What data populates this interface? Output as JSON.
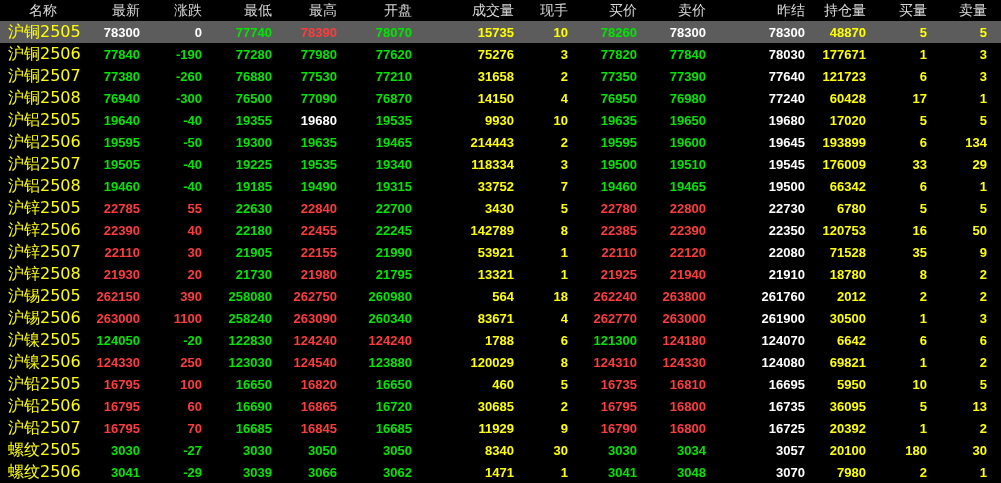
{
  "table": {
    "columns": [
      "名称",
      "最新",
      "涨跌",
      "最低",
      "最高",
      "开盘",
      "成交量",
      "现手",
      "买价",
      "卖价",
      "昨结",
      "持仓量",
      "买量",
      "卖量"
    ],
    "rows": [
      {
        "selected": true,
        "cells": [
          {
            "text": "沪铜2505",
            "color": "#ffff00"
          },
          {
            "text": "78300",
            "color": "#ffffff"
          },
          {
            "text": "0",
            "color": "#ffffff"
          },
          {
            "text": "77740",
            "color": "#00e600"
          },
          {
            "text": "78390",
            "color": "#ff3c3c"
          },
          {
            "text": "78070",
            "color": "#00e600"
          },
          {
            "text": "15735",
            "color": "#ffff00"
          },
          {
            "text": "10",
            "color": "#ffff00"
          },
          {
            "text": "78260",
            "color": "#00e600"
          },
          {
            "text": "78300",
            "color": "#ffffff"
          },
          {
            "text": "78300",
            "color": "#ffffff"
          },
          {
            "text": "48870",
            "color": "#ffff00"
          },
          {
            "text": "5",
            "color": "#ffff00"
          },
          {
            "text": "5",
            "color": "#ffff00"
          }
        ]
      },
      {
        "selected": false,
        "cells": [
          {
            "text": "沪铜2506",
            "color": "#ffff00"
          },
          {
            "text": "77840",
            "color": "#00e600"
          },
          {
            "text": "-190",
            "color": "#00e600"
          },
          {
            "text": "77280",
            "color": "#00e600"
          },
          {
            "text": "77980",
            "color": "#00e600"
          },
          {
            "text": "77620",
            "color": "#00e600"
          },
          {
            "text": "75276",
            "color": "#ffff00"
          },
          {
            "text": "3",
            "color": "#ffff00"
          },
          {
            "text": "77820",
            "color": "#00e600"
          },
          {
            "text": "77840",
            "color": "#00e600"
          },
          {
            "text": "78030",
            "color": "#ffffff"
          },
          {
            "text": "177671",
            "color": "#ffff00"
          },
          {
            "text": "1",
            "color": "#ffff00"
          },
          {
            "text": "3",
            "color": "#ffff00"
          }
        ]
      },
      {
        "selected": false,
        "cells": [
          {
            "text": "沪铜2507",
            "color": "#ffff00"
          },
          {
            "text": "77380",
            "color": "#00e600"
          },
          {
            "text": "-260",
            "color": "#00e600"
          },
          {
            "text": "76880",
            "color": "#00e600"
          },
          {
            "text": "77530",
            "color": "#00e600"
          },
          {
            "text": "77210",
            "color": "#00e600"
          },
          {
            "text": "31658",
            "color": "#ffff00"
          },
          {
            "text": "2",
            "color": "#ffff00"
          },
          {
            "text": "77350",
            "color": "#00e600"
          },
          {
            "text": "77390",
            "color": "#00e600"
          },
          {
            "text": "77640",
            "color": "#ffffff"
          },
          {
            "text": "121723",
            "color": "#ffff00"
          },
          {
            "text": "6",
            "color": "#ffff00"
          },
          {
            "text": "3",
            "color": "#ffff00"
          }
        ]
      },
      {
        "selected": false,
        "cells": [
          {
            "text": "沪铜2508",
            "color": "#ffff00"
          },
          {
            "text": "76940",
            "color": "#00e600"
          },
          {
            "text": "-300",
            "color": "#00e600"
          },
          {
            "text": "76500",
            "color": "#00e600"
          },
          {
            "text": "77090",
            "color": "#00e600"
          },
          {
            "text": "76870",
            "color": "#00e600"
          },
          {
            "text": "14150",
            "color": "#ffff00"
          },
          {
            "text": "4",
            "color": "#ffff00"
          },
          {
            "text": "76950",
            "color": "#00e600"
          },
          {
            "text": "76980",
            "color": "#00e600"
          },
          {
            "text": "77240",
            "color": "#ffffff"
          },
          {
            "text": "60428",
            "color": "#ffff00"
          },
          {
            "text": "17",
            "color": "#ffff00"
          },
          {
            "text": "1",
            "color": "#ffff00"
          }
        ]
      },
      {
        "selected": false,
        "cells": [
          {
            "text": "沪铝2505",
            "color": "#ffff00"
          },
          {
            "text": "19640",
            "color": "#00e600"
          },
          {
            "text": "-40",
            "color": "#00e600"
          },
          {
            "text": "19355",
            "color": "#00e600"
          },
          {
            "text": "19680",
            "color": "#ffffff"
          },
          {
            "text": "19535",
            "color": "#00e600"
          },
          {
            "text": "9930",
            "color": "#ffff00"
          },
          {
            "text": "10",
            "color": "#ffff00"
          },
          {
            "text": "19635",
            "color": "#00e600"
          },
          {
            "text": "19650",
            "color": "#00e600"
          },
          {
            "text": "19680",
            "color": "#ffffff"
          },
          {
            "text": "17020",
            "color": "#ffff00"
          },
          {
            "text": "5",
            "color": "#ffff00"
          },
          {
            "text": "5",
            "color": "#ffff00"
          }
        ]
      },
      {
        "selected": false,
        "cells": [
          {
            "text": "沪铝2506",
            "color": "#ffff00"
          },
          {
            "text": "19595",
            "color": "#00e600"
          },
          {
            "text": "-50",
            "color": "#00e600"
          },
          {
            "text": "19300",
            "color": "#00e600"
          },
          {
            "text": "19635",
            "color": "#00e600"
          },
          {
            "text": "19465",
            "color": "#00e600"
          },
          {
            "text": "214443",
            "color": "#ffff00"
          },
          {
            "text": "2",
            "color": "#ffff00"
          },
          {
            "text": "19595",
            "color": "#00e600"
          },
          {
            "text": "19600",
            "color": "#00e600"
          },
          {
            "text": "19645",
            "color": "#ffffff"
          },
          {
            "text": "193899",
            "color": "#ffff00"
          },
          {
            "text": "6",
            "color": "#ffff00"
          },
          {
            "text": "134",
            "color": "#ffff00"
          }
        ]
      },
      {
        "selected": false,
        "cells": [
          {
            "text": "沪铝2507",
            "color": "#ffff00"
          },
          {
            "text": "19505",
            "color": "#00e600"
          },
          {
            "text": "-40",
            "color": "#00e600"
          },
          {
            "text": "19225",
            "color": "#00e600"
          },
          {
            "text": "19535",
            "color": "#00e600"
          },
          {
            "text": "19340",
            "color": "#00e600"
          },
          {
            "text": "118334",
            "color": "#ffff00"
          },
          {
            "text": "3",
            "color": "#ffff00"
          },
          {
            "text": "19500",
            "color": "#00e600"
          },
          {
            "text": "19510",
            "color": "#00e600"
          },
          {
            "text": "19545",
            "color": "#ffffff"
          },
          {
            "text": "176009",
            "color": "#ffff00"
          },
          {
            "text": "33",
            "color": "#ffff00"
          },
          {
            "text": "29",
            "color": "#ffff00"
          }
        ]
      },
      {
        "selected": false,
        "cells": [
          {
            "text": "沪铝2508",
            "color": "#ffff00"
          },
          {
            "text": "19460",
            "color": "#00e600"
          },
          {
            "text": "-40",
            "color": "#00e600"
          },
          {
            "text": "19185",
            "color": "#00e600"
          },
          {
            "text": "19490",
            "color": "#00e600"
          },
          {
            "text": "19315",
            "color": "#00e600"
          },
          {
            "text": "33752",
            "color": "#ffff00"
          },
          {
            "text": "7",
            "color": "#ffff00"
          },
          {
            "text": "19460",
            "color": "#00e600"
          },
          {
            "text": "19465",
            "color": "#00e600"
          },
          {
            "text": "19500",
            "color": "#ffffff"
          },
          {
            "text": "66342",
            "color": "#ffff00"
          },
          {
            "text": "6",
            "color": "#ffff00"
          },
          {
            "text": "1",
            "color": "#ffff00"
          }
        ]
      },
      {
        "selected": false,
        "cells": [
          {
            "text": "沪锌2505",
            "color": "#ffff00"
          },
          {
            "text": "22785",
            "color": "#ff3c3c"
          },
          {
            "text": "55",
            "color": "#ff3c3c"
          },
          {
            "text": "22630",
            "color": "#00e600"
          },
          {
            "text": "22840",
            "color": "#ff3c3c"
          },
          {
            "text": "22700",
            "color": "#00e600"
          },
          {
            "text": "3430",
            "color": "#ffff00"
          },
          {
            "text": "5",
            "color": "#ffff00"
          },
          {
            "text": "22780",
            "color": "#ff3c3c"
          },
          {
            "text": "22800",
            "color": "#ff3c3c"
          },
          {
            "text": "22730",
            "color": "#ffffff"
          },
          {
            "text": "6780",
            "color": "#ffff00"
          },
          {
            "text": "5",
            "color": "#ffff00"
          },
          {
            "text": "5",
            "color": "#ffff00"
          }
        ]
      },
      {
        "selected": false,
        "cells": [
          {
            "text": "沪锌2506",
            "color": "#ffff00"
          },
          {
            "text": "22390",
            "color": "#ff3c3c"
          },
          {
            "text": "40",
            "color": "#ff3c3c"
          },
          {
            "text": "22180",
            "color": "#00e600"
          },
          {
            "text": "22455",
            "color": "#ff3c3c"
          },
          {
            "text": "22245",
            "color": "#00e600"
          },
          {
            "text": "142789",
            "color": "#ffff00"
          },
          {
            "text": "8",
            "color": "#ffff00"
          },
          {
            "text": "22385",
            "color": "#ff3c3c"
          },
          {
            "text": "22390",
            "color": "#ff3c3c"
          },
          {
            "text": "22350",
            "color": "#ffffff"
          },
          {
            "text": "120753",
            "color": "#ffff00"
          },
          {
            "text": "16",
            "color": "#ffff00"
          },
          {
            "text": "50",
            "color": "#ffff00"
          }
        ]
      },
      {
        "selected": false,
        "cells": [
          {
            "text": "沪锌2507",
            "color": "#ffff00"
          },
          {
            "text": "22110",
            "color": "#ff3c3c"
          },
          {
            "text": "30",
            "color": "#ff3c3c"
          },
          {
            "text": "21905",
            "color": "#00e600"
          },
          {
            "text": "22155",
            "color": "#ff3c3c"
          },
          {
            "text": "21990",
            "color": "#00e600"
          },
          {
            "text": "53921",
            "color": "#ffff00"
          },
          {
            "text": "1",
            "color": "#ffff00"
          },
          {
            "text": "22110",
            "color": "#ff3c3c"
          },
          {
            "text": "22120",
            "color": "#ff3c3c"
          },
          {
            "text": "22080",
            "color": "#ffffff"
          },
          {
            "text": "71528",
            "color": "#ffff00"
          },
          {
            "text": "35",
            "color": "#ffff00"
          },
          {
            "text": "9",
            "color": "#ffff00"
          }
        ]
      },
      {
        "selected": false,
        "cells": [
          {
            "text": "沪锌2508",
            "color": "#ffff00"
          },
          {
            "text": "21930",
            "color": "#ff3c3c"
          },
          {
            "text": "20",
            "color": "#ff3c3c"
          },
          {
            "text": "21730",
            "color": "#00e600"
          },
          {
            "text": "21980",
            "color": "#ff3c3c"
          },
          {
            "text": "21795",
            "color": "#00e600"
          },
          {
            "text": "13321",
            "color": "#ffff00"
          },
          {
            "text": "1",
            "color": "#ffff00"
          },
          {
            "text": "21925",
            "color": "#ff3c3c"
          },
          {
            "text": "21940",
            "color": "#ff3c3c"
          },
          {
            "text": "21910",
            "color": "#ffffff"
          },
          {
            "text": "18780",
            "color": "#ffff00"
          },
          {
            "text": "8",
            "color": "#ffff00"
          },
          {
            "text": "2",
            "color": "#ffff00"
          }
        ]
      },
      {
        "selected": false,
        "cells": [
          {
            "text": "沪锡2505",
            "color": "#ffff00"
          },
          {
            "text": "262150",
            "color": "#ff3c3c"
          },
          {
            "text": "390",
            "color": "#ff3c3c"
          },
          {
            "text": "258080",
            "color": "#00e600"
          },
          {
            "text": "262750",
            "color": "#ff3c3c"
          },
          {
            "text": "260980",
            "color": "#00e600"
          },
          {
            "text": "564",
            "color": "#ffff00"
          },
          {
            "text": "18",
            "color": "#ffff00"
          },
          {
            "text": "262240",
            "color": "#ff3c3c"
          },
          {
            "text": "263800",
            "color": "#ff3c3c"
          },
          {
            "text": "261760",
            "color": "#ffffff"
          },
          {
            "text": "2012",
            "color": "#ffff00"
          },
          {
            "text": "2",
            "color": "#ffff00"
          },
          {
            "text": "2",
            "color": "#ffff00"
          }
        ]
      },
      {
        "selected": false,
        "cells": [
          {
            "text": "沪锡2506",
            "color": "#ffff00"
          },
          {
            "text": "263000",
            "color": "#ff3c3c"
          },
          {
            "text": "1100",
            "color": "#ff3c3c"
          },
          {
            "text": "258240",
            "color": "#00e600"
          },
          {
            "text": "263090",
            "color": "#ff3c3c"
          },
          {
            "text": "260340",
            "color": "#00e600"
          },
          {
            "text": "83671",
            "color": "#ffff00"
          },
          {
            "text": "4",
            "color": "#ffff00"
          },
          {
            "text": "262770",
            "color": "#ff3c3c"
          },
          {
            "text": "263000",
            "color": "#ff3c3c"
          },
          {
            "text": "261900",
            "color": "#ffffff"
          },
          {
            "text": "30500",
            "color": "#ffff00"
          },
          {
            "text": "1",
            "color": "#ffff00"
          },
          {
            "text": "3",
            "color": "#ffff00"
          }
        ]
      },
      {
        "selected": false,
        "cells": [
          {
            "text": "沪镍2505",
            "color": "#ffff00"
          },
          {
            "text": "124050",
            "color": "#00e600"
          },
          {
            "text": "-20",
            "color": "#00e600"
          },
          {
            "text": "122830",
            "color": "#00e600"
          },
          {
            "text": "124240",
            "color": "#ff3c3c"
          },
          {
            "text": "124240",
            "color": "#ff3c3c"
          },
          {
            "text": "1788",
            "color": "#ffff00"
          },
          {
            "text": "6",
            "color": "#ffff00"
          },
          {
            "text": "121300",
            "color": "#00e600"
          },
          {
            "text": "124180",
            "color": "#ff3c3c"
          },
          {
            "text": "124070",
            "color": "#ffffff"
          },
          {
            "text": "6642",
            "color": "#ffff00"
          },
          {
            "text": "6",
            "color": "#ffff00"
          },
          {
            "text": "6",
            "color": "#ffff00"
          }
        ]
      },
      {
        "selected": false,
        "cells": [
          {
            "text": "沪镍2506",
            "color": "#ffff00"
          },
          {
            "text": "124330",
            "color": "#ff3c3c"
          },
          {
            "text": "250",
            "color": "#ff3c3c"
          },
          {
            "text": "123030",
            "color": "#00e600"
          },
          {
            "text": "124540",
            "color": "#ff3c3c"
          },
          {
            "text": "123880",
            "color": "#00e600"
          },
          {
            "text": "120029",
            "color": "#ffff00"
          },
          {
            "text": "8",
            "color": "#ffff00"
          },
          {
            "text": "124310",
            "color": "#ff3c3c"
          },
          {
            "text": "124330",
            "color": "#ff3c3c"
          },
          {
            "text": "124080",
            "color": "#ffffff"
          },
          {
            "text": "69821",
            "color": "#ffff00"
          },
          {
            "text": "1",
            "color": "#ffff00"
          },
          {
            "text": "2",
            "color": "#ffff00"
          }
        ]
      },
      {
        "selected": false,
        "cells": [
          {
            "text": "沪铅2505",
            "color": "#ffff00"
          },
          {
            "text": "16795",
            "color": "#ff3c3c"
          },
          {
            "text": "100",
            "color": "#ff3c3c"
          },
          {
            "text": "16650",
            "color": "#00e600"
          },
          {
            "text": "16820",
            "color": "#ff3c3c"
          },
          {
            "text": "16650",
            "color": "#00e600"
          },
          {
            "text": "460",
            "color": "#ffff00"
          },
          {
            "text": "5",
            "color": "#ffff00"
          },
          {
            "text": "16735",
            "color": "#ff3c3c"
          },
          {
            "text": "16810",
            "color": "#ff3c3c"
          },
          {
            "text": "16695",
            "color": "#ffffff"
          },
          {
            "text": "5950",
            "color": "#ffff00"
          },
          {
            "text": "10",
            "color": "#ffff00"
          },
          {
            "text": "5",
            "color": "#ffff00"
          }
        ]
      },
      {
        "selected": false,
        "cells": [
          {
            "text": "沪铅2506",
            "color": "#ffff00"
          },
          {
            "text": "16795",
            "color": "#ff3c3c"
          },
          {
            "text": "60",
            "color": "#ff3c3c"
          },
          {
            "text": "16690",
            "color": "#00e600"
          },
          {
            "text": "16865",
            "color": "#ff3c3c"
          },
          {
            "text": "16720",
            "color": "#00e600"
          },
          {
            "text": "30685",
            "color": "#ffff00"
          },
          {
            "text": "2",
            "color": "#ffff00"
          },
          {
            "text": "16795",
            "color": "#ff3c3c"
          },
          {
            "text": "16800",
            "color": "#ff3c3c"
          },
          {
            "text": "16735",
            "color": "#ffffff"
          },
          {
            "text": "36095",
            "color": "#ffff00"
          },
          {
            "text": "5",
            "color": "#ffff00"
          },
          {
            "text": "13",
            "color": "#ffff00"
          }
        ]
      },
      {
        "selected": false,
        "cells": [
          {
            "text": "沪铅2507",
            "color": "#ffff00"
          },
          {
            "text": "16795",
            "color": "#ff3c3c"
          },
          {
            "text": "70",
            "color": "#ff3c3c"
          },
          {
            "text": "16685",
            "color": "#00e600"
          },
          {
            "text": "16845",
            "color": "#ff3c3c"
          },
          {
            "text": "16685",
            "color": "#00e600"
          },
          {
            "text": "11929",
            "color": "#ffff00"
          },
          {
            "text": "9",
            "color": "#ffff00"
          },
          {
            "text": "16790",
            "color": "#ff3c3c"
          },
          {
            "text": "16800",
            "color": "#ff3c3c"
          },
          {
            "text": "16725",
            "color": "#ffffff"
          },
          {
            "text": "20392",
            "color": "#ffff00"
          },
          {
            "text": "1",
            "color": "#ffff00"
          },
          {
            "text": "2",
            "color": "#ffff00"
          }
        ]
      },
      {
        "selected": false,
        "cells": [
          {
            "text": "螺纹2505",
            "color": "#ffff00"
          },
          {
            "text": "3030",
            "color": "#00e600"
          },
          {
            "text": "-27",
            "color": "#00e600"
          },
          {
            "text": "3030",
            "color": "#00e600"
          },
          {
            "text": "3050",
            "color": "#00e600"
          },
          {
            "text": "3050",
            "color": "#00e600"
          },
          {
            "text": "8340",
            "color": "#ffff00"
          },
          {
            "text": "30",
            "color": "#ffff00"
          },
          {
            "text": "3030",
            "color": "#00e600"
          },
          {
            "text": "3034",
            "color": "#00e600"
          },
          {
            "text": "3057",
            "color": "#ffffff"
          },
          {
            "text": "20100",
            "color": "#ffff00"
          },
          {
            "text": "180",
            "color": "#ffff00"
          },
          {
            "text": "30",
            "color": "#ffff00"
          }
        ]
      },
      {
        "selected": false,
        "cells": [
          {
            "text": "螺纹2506",
            "color": "#ffff00"
          },
          {
            "text": "3041",
            "color": "#00e600"
          },
          {
            "text": "-29",
            "color": "#00e600"
          },
          {
            "text": "3039",
            "color": "#00e600"
          },
          {
            "text": "3066",
            "color": "#00e600"
          },
          {
            "text": "3062",
            "color": "#00e600"
          },
          {
            "text": "1471",
            "color": "#ffff00"
          },
          {
            "text": "1",
            "color": "#ffff00"
          },
          {
            "text": "3041",
            "color": "#00e600"
          },
          {
            "text": "3048",
            "color": "#00e600"
          },
          {
            "text": "3070",
            "color": "#ffffff"
          },
          {
            "text": "7980",
            "color": "#ffff00"
          },
          {
            "text": "2",
            "color": "#ffff00"
          },
          {
            "text": "1",
            "color": "#ffff00"
          }
        ]
      }
    ]
  }
}
